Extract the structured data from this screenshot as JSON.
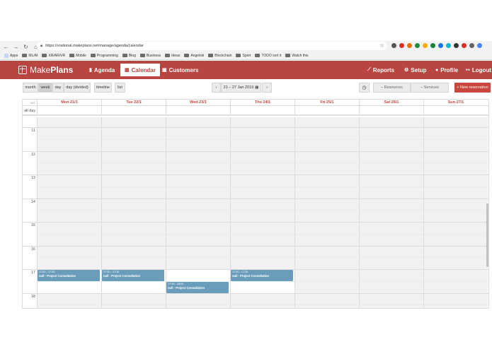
{
  "browser": {
    "url": "https://vrational.makeplans.net/manage/agenda/calendar",
    "bookmarks": [
      "Apps",
      "ML/AI",
      "XR/AR/VR",
      "Mobile",
      "Programming",
      "Blog",
      "Business",
      "Ideas",
      "Angelski",
      "Blockchain",
      "Sport",
      "TODO sort it",
      "Watch this"
    ],
    "extension_colors": [
      "#555555",
      "#d93025",
      "#e8710a",
      "#1e8e3e",
      "#f9ab00",
      "#188038",
      "#1a73e8",
      "#12b5cb",
      "#333333",
      "#d93025",
      "#5f6368",
      "#4285f4"
    ]
  },
  "app": {
    "logo_light": "Make",
    "logo_bold": "Plans",
    "nav": {
      "agenda": "Agenda",
      "calendar": "Calendar",
      "customers": "Customers",
      "reports": "Reports",
      "setup": "Setup",
      "profile": "Profile",
      "logout": "Logout"
    },
    "brand_color": "#b94540"
  },
  "toolbar": {
    "month": "month",
    "week": "week",
    "day": "day",
    "day_divided": "day (divided)",
    "timeline": "timeline",
    "list": "list",
    "prev": "‹",
    "range": "21 – 27 Jan 2019",
    "next": "›",
    "resources": "– Resources",
    "services": "– Services",
    "new_reservation": "+ New reservation"
  },
  "calendar": {
    "week_label": "w4",
    "all_day_label": "all-day",
    "days": [
      "Mon 21/1",
      "Tue 22/1",
      "Wed 23/1",
      "Thu 24/1",
      "Fri 25/1",
      "Sat 26/1",
      "Sun 27/1"
    ],
    "hours": [
      "11",
      "12",
      "13",
      "14",
      "15",
      "16",
      "17",
      "18"
    ],
    "events": [
      {
        "day": 0,
        "time": "17:00 - 17:30",
        "title": "null - Project Consultation"
      },
      {
        "day": 1,
        "time": "17:00 - 17:30",
        "title": "null - Project Consultation"
      },
      {
        "day": 2,
        "time": "17:30 - 18:00",
        "title": "null - Project Consultation"
      },
      {
        "day": 3,
        "time": "17:00 - 17:30",
        "title": "null - Project Consultation"
      }
    ],
    "event_color": "#6a9dbb"
  }
}
